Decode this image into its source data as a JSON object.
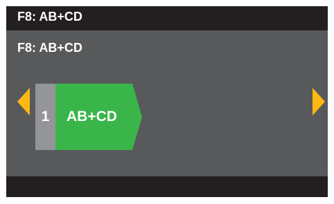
{
  "header": {
    "title": "F8: AB+CD"
  },
  "content": {
    "subtitle": "F8: AB+CD"
  },
  "step": {
    "number": "1",
    "label": "AB+CD"
  },
  "icons": {
    "left": "arrow-left-icon",
    "right": "arrow-right-icon"
  },
  "colors": {
    "background": "#58595b",
    "bar": "#231f20",
    "accent_arrow": "#fdb813",
    "step_active": "#39b54a",
    "step_number_bg": "#939598",
    "text": "#ffffff"
  }
}
